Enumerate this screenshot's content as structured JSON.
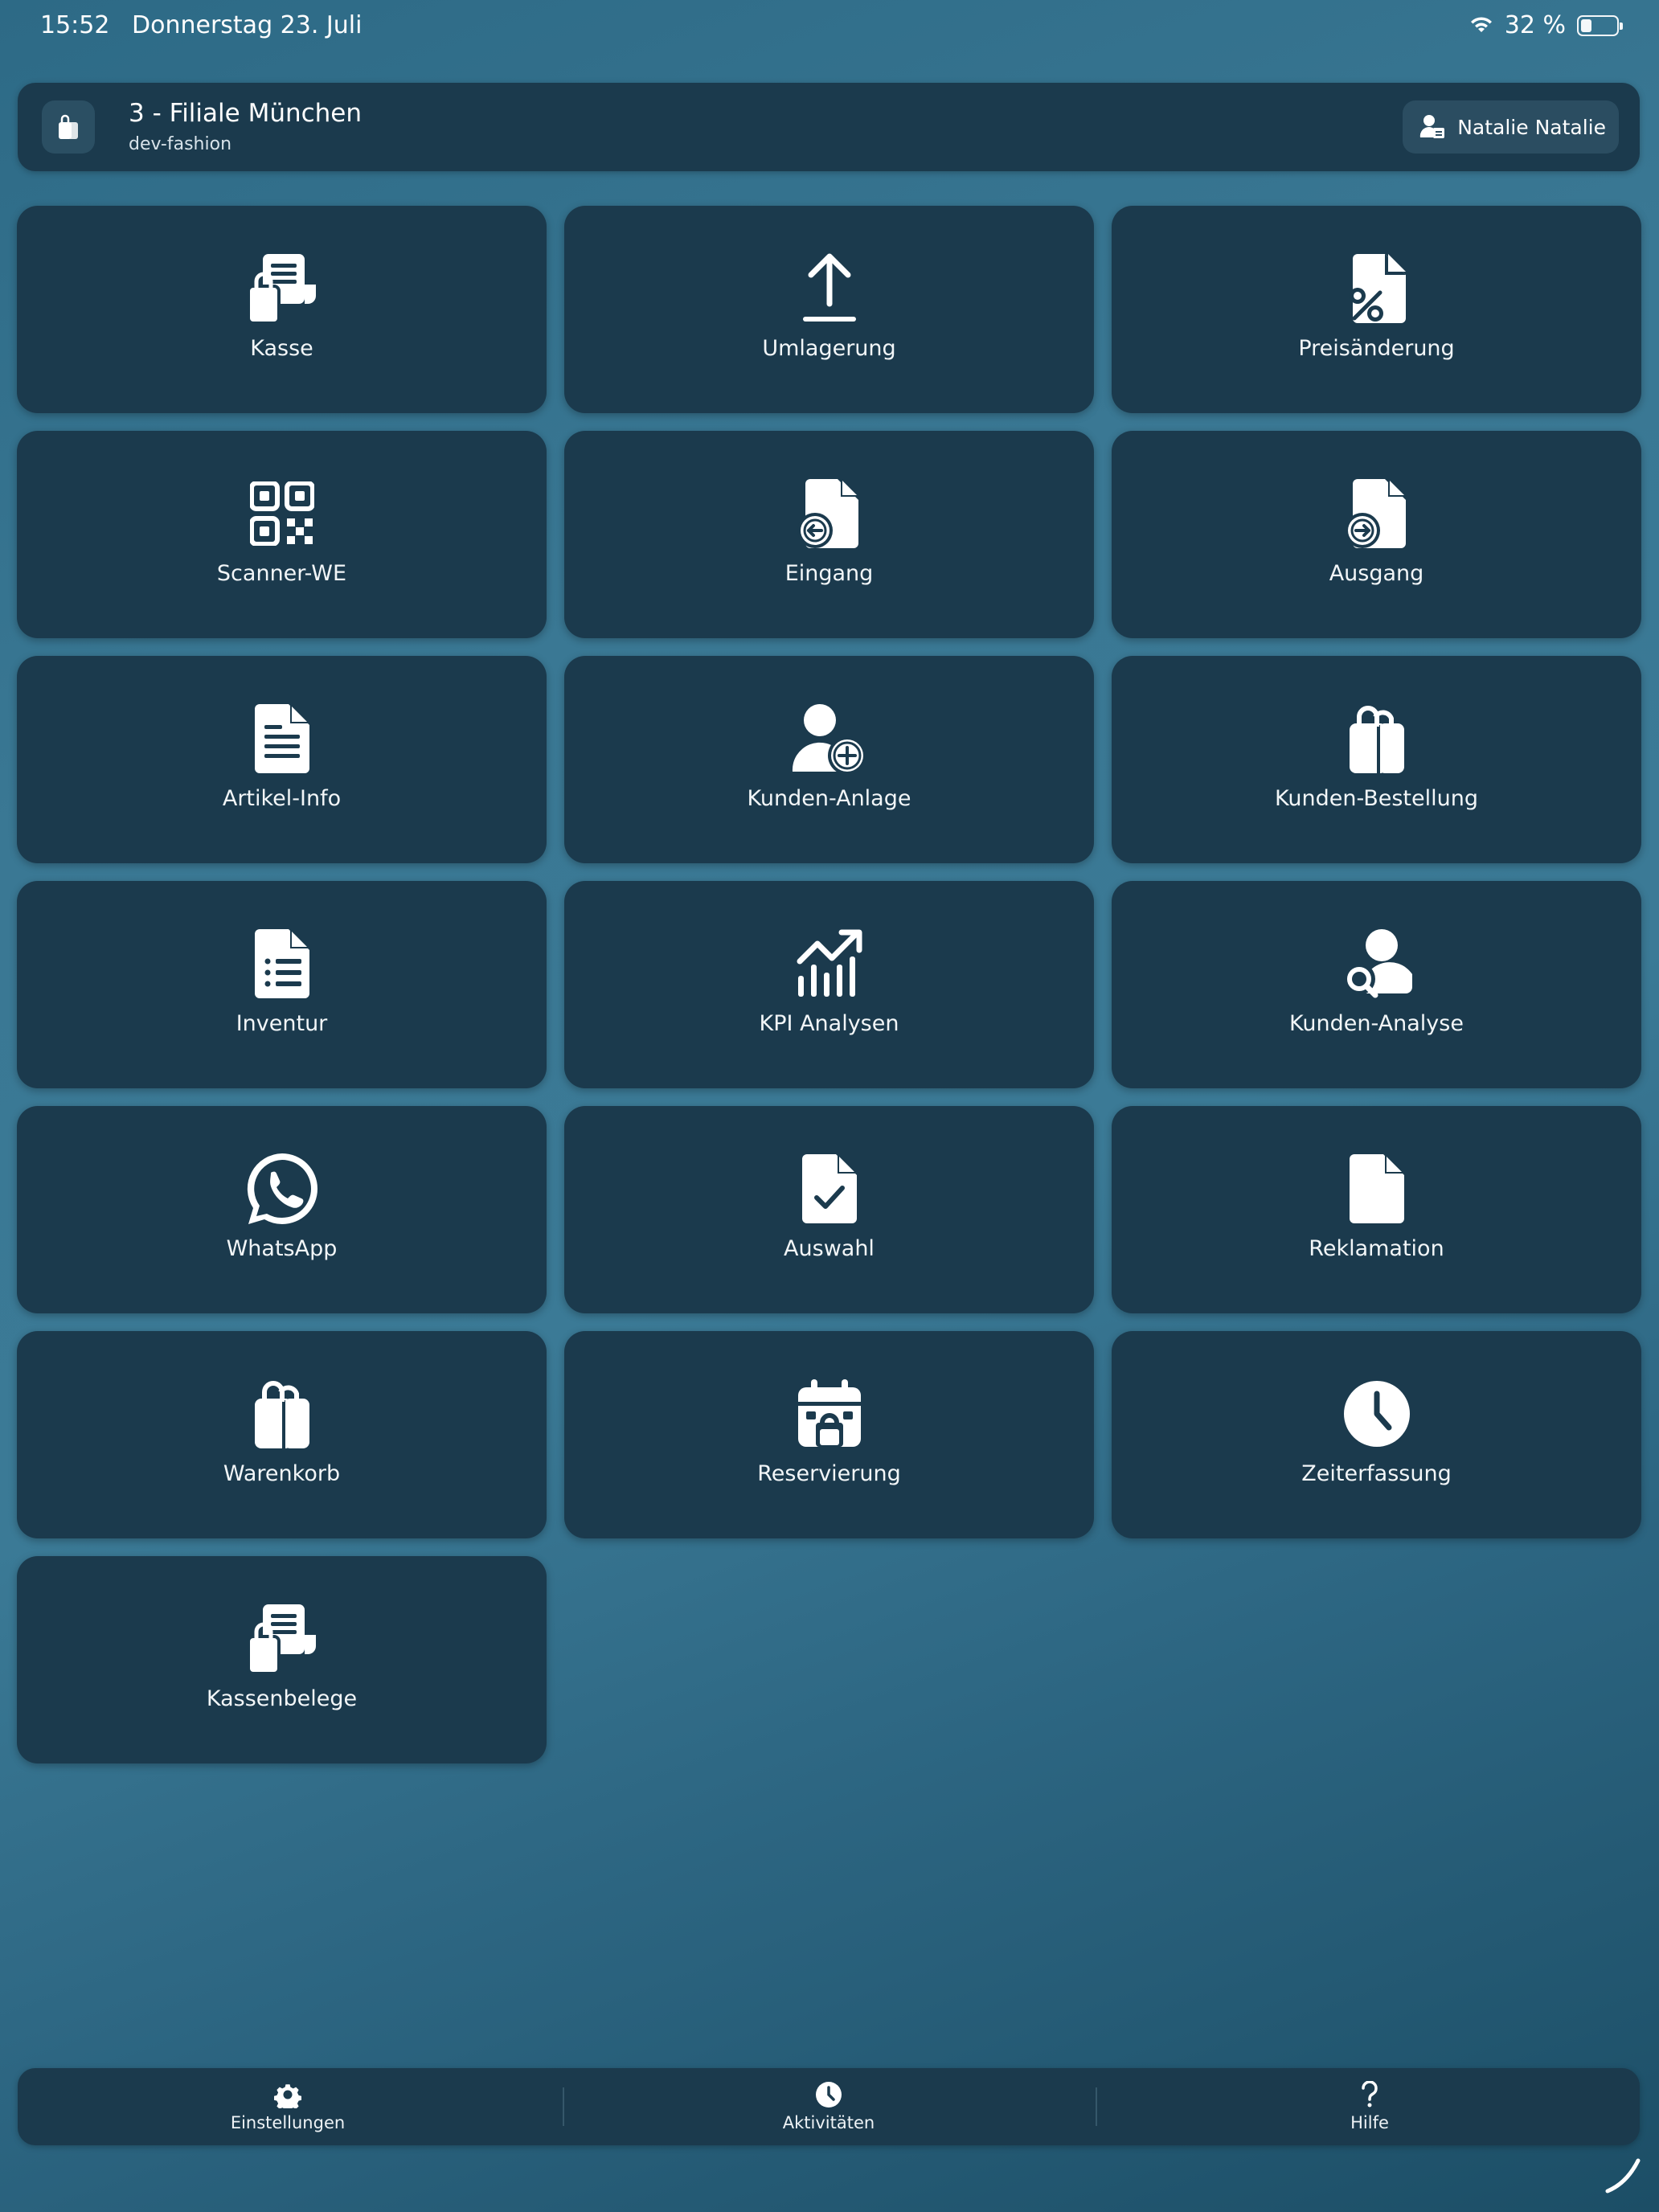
{
  "status": {
    "time": "15:52",
    "date": "Donnerstag 23. Juli",
    "battery": "32 %",
    "battery_level": 0.32
  },
  "header": {
    "title": "3 - Filiale München",
    "subtitle": "dev-fashion",
    "user": "Natalie Natalie"
  },
  "tiles": [
    {
      "label": "Kasse",
      "icon": "register-bag-icon"
    },
    {
      "label": "Umlagerung",
      "icon": "upload-arrow-icon"
    },
    {
      "label": "Preisänderung",
      "icon": "document-percent-icon"
    },
    {
      "label": "Scanner-WE",
      "icon": "qr-code-icon"
    },
    {
      "label": "Eingang",
      "icon": "document-arrow-in-icon"
    },
    {
      "label": "Ausgang",
      "icon": "document-arrow-out-icon"
    },
    {
      "label": "Artikel-Info",
      "icon": "document-text-icon"
    },
    {
      "label": "Kunden-Anlage",
      "icon": "user-plus-icon"
    },
    {
      "label": "Kunden-Bestellung",
      "icon": "shopping-bag-icon"
    },
    {
      "label": "Inventur",
      "icon": "document-list-icon"
    },
    {
      "label": "KPI Analysen",
      "icon": "chart-up-icon"
    },
    {
      "label": "Kunden-Analyse",
      "icon": "user-search-icon"
    },
    {
      "label": "WhatsApp",
      "icon": "whatsapp-icon"
    },
    {
      "label": "Auswahl",
      "icon": "document-check-icon"
    },
    {
      "label": "Reklamation",
      "icon": "document-icon"
    },
    {
      "label": "Warenkorb",
      "icon": "shopping-bag-icon"
    },
    {
      "label": "Reservierung",
      "icon": "calendar-lock-icon"
    },
    {
      "label": "Zeiterfassung",
      "icon": "clock-icon"
    },
    {
      "label": "Kassenbelege",
      "icon": "register-bag-icon"
    }
  ],
  "nav": [
    {
      "label": "Einstellungen",
      "icon": "gear-icon"
    },
    {
      "label": "Aktivitäten",
      "icon": "clock-icon"
    },
    {
      "label": "Hilfe",
      "icon": "question-icon"
    }
  ]
}
